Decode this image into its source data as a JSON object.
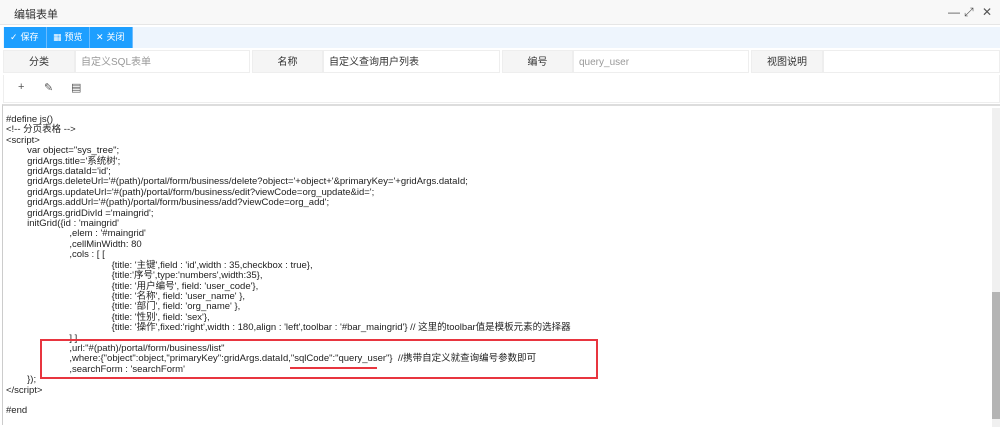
{
  "window": {
    "title": "编辑表单",
    "minimize": "—",
    "maximize": "⤢",
    "close": "✕"
  },
  "toolbar": {
    "save": "保存",
    "preview": "预览",
    "close": "关闭"
  },
  "form": {
    "category_label": "分类",
    "category_placeholder": "自定义SQL表单",
    "name_label": "名称",
    "name_value": "自定义查询用户列表",
    "code_label": "编号",
    "code_value": "query_user",
    "view_desc_label": "视图说明",
    "view_desc_value": ""
  },
  "icons": {
    "add": "+",
    "edit": "✎",
    "list": "▤"
  },
  "editor": {
    "code": "#define js()\n<!-- 分页表格 -->\n<script>\n        var object=\"sys_tree\";\n        gridArgs.title='系统树';\n        gridArgs.dataId='id';\n        gridArgs.deleteUrl='#(path)/portal/form/business/delete?object='+object+'&primaryKey='+gridArgs.dataId;\n        gridArgs.updateUrl='#(path)/portal/form/business/edit?viewCode=org_update&id=';\n        gridArgs.addUrl='#(path)/portal/form/business/add?viewCode=org_add';\n        gridArgs.gridDivId ='maingrid';\n        initGrid({id : 'maingrid'\n                        ,elem : '#maingrid'\n                        ,cellMinWidth: 80\n                        ,cols : [ [\n                                        {title: '主键',field : 'id',width : 35,checkbox : true},\n                                        {title:'序号',type:'numbers',width:35},\n                                        {title: '用户编号', field: 'user_code'},\n                                        {title: '名称', field: 'user_name' },\n                                        {title: '部门', field: 'org_name' },\n                                        {title: '性别', field: 'sex'},\n                                        {title: '操作',fixed:'right',width : 180,align : 'left',toolbar : '#bar_maingrid'} // 这里的toolbar值是模板元素的选择器\n                        ] ]\n                        ,url:\"#(path)/portal/form/business/list\"\n                        ,where:{\"object\":object,\"primaryKey\":gridArgs.dataId,\"sqlCode\":\"query_user\"}  //携带自定义就查询编号参数即可\n                        ,searchForm : 'searchForm'\n        });\n</script>\n\n#end"
  },
  "colors": {
    "accent": "#1e9fff",
    "highlight": "#e8353f"
  }
}
